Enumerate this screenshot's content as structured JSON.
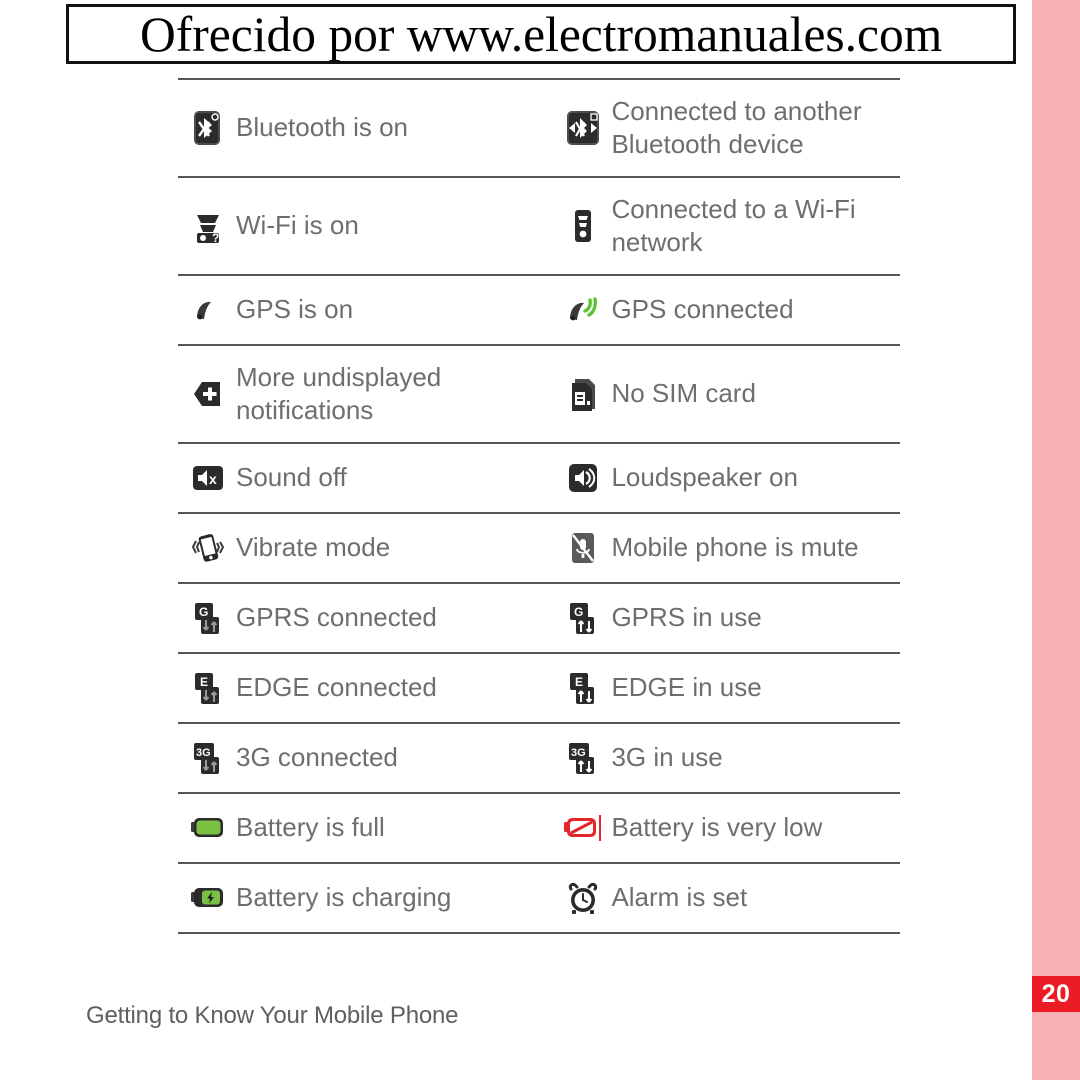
{
  "watermark": {
    "text": "Ofrecido por www.electromanuales.com"
  },
  "footer": {
    "chapter_label": "Getting to Know Your Mobile Phone",
    "page_number": "20"
  },
  "colors": {
    "accent_red": "#ec1c24",
    "stripe_pink": "#f9b3b6",
    "label_gray": "#6e6e6e",
    "icon_dark": "#2b2b2b",
    "battery_green": "#7ac143",
    "gps_green": "#5cc430",
    "battery_low_red": "#e3262b"
  },
  "table": {
    "rows": [
      {
        "left": {
          "icon": "bluetooth-on-icon",
          "label": "Bluetooth is on"
        },
        "right": {
          "icon": "bluetooth-connected-icon",
          "label": "Connected to another Bluetooth device"
        }
      },
      {
        "left": {
          "icon": "wifi-on-icon",
          "label": "Wi-Fi is on"
        },
        "right": {
          "icon": "wifi-connected-icon",
          "label": "Connected to a Wi-Fi network"
        }
      },
      {
        "left": {
          "icon": "gps-on-icon",
          "label": "GPS is on"
        },
        "right": {
          "icon": "gps-connected-icon",
          "label": "GPS connected"
        }
      },
      {
        "left": {
          "icon": "more-notifications-icon",
          "label": "More undisplayed notifications"
        },
        "right": {
          "icon": "no-sim-card-icon",
          "label": "No SIM card"
        }
      },
      {
        "left": {
          "icon": "sound-off-icon",
          "label": "Sound off"
        },
        "right": {
          "icon": "loudspeaker-on-icon",
          "label": "Loudspeaker on"
        }
      },
      {
        "left": {
          "icon": "vibrate-mode-icon",
          "label": "Vibrate mode"
        },
        "right": {
          "icon": "phone-mute-icon",
          "label": "Mobile phone is mute"
        }
      },
      {
        "left": {
          "icon": "gprs-connected-icon",
          "label": "GPRS connected"
        },
        "right": {
          "icon": "gprs-in-use-icon",
          "label": "GPRS in use"
        }
      },
      {
        "left": {
          "icon": "edge-connected-icon",
          "label": "EDGE connected"
        },
        "right": {
          "icon": "edge-in-use-icon",
          "label": "EDGE in use"
        }
      },
      {
        "left": {
          "icon": "threeg-connected-icon",
          "label": "3G connected"
        },
        "right": {
          "icon": "threeg-in-use-icon",
          "label": "3G in use"
        }
      },
      {
        "left": {
          "icon": "battery-full-icon",
          "label": "Battery is full"
        },
        "right": {
          "icon": "battery-very-low-icon",
          "label": "Battery is very low"
        }
      },
      {
        "left": {
          "icon": "battery-charging-icon",
          "label": "Battery is charging"
        },
        "right": {
          "icon": "alarm-set-icon",
          "label": "Alarm is set"
        }
      }
    ]
  }
}
